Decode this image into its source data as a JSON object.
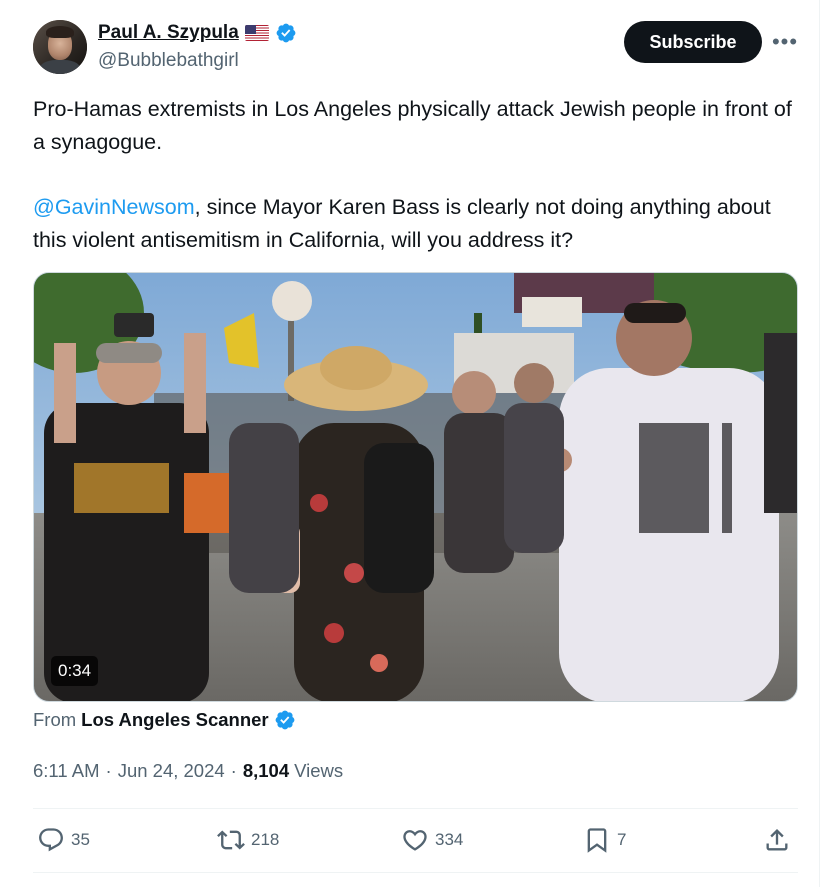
{
  "author": {
    "name": "Paul A. Szypula",
    "handle": "@Bubblebathgirl",
    "flag": "us-flag-icon",
    "verified_icon": "verified-badge-icon"
  },
  "header": {
    "subscribe_label": "Subscribe",
    "more_label": "•••"
  },
  "tweet": {
    "line1": "Pro-Hamas extremists in Los Angeles physically attack Jewish people in front of a synagogue.",
    "mention": "@GavinNewsom",
    "line2_rest": ", since Mayor Karen Bass is clearly not doing anything about this violent antisemitism in California, will you address it?"
  },
  "media": {
    "duration": "0:34",
    "type": "video"
  },
  "source": {
    "from_label": "From",
    "name": "Los Angeles Scanner"
  },
  "meta": {
    "time": "6:11 AM",
    "separator": "·",
    "date": "Jun 24, 2024",
    "views_count": "8,104",
    "views_label": "Views"
  },
  "actions": {
    "replies": "35",
    "reposts": "218",
    "likes": "334",
    "bookmarks": "7"
  },
  "colors": {
    "accent": "#1d9bf0",
    "text": "#0f1419",
    "secondary": "#536471"
  }
}
